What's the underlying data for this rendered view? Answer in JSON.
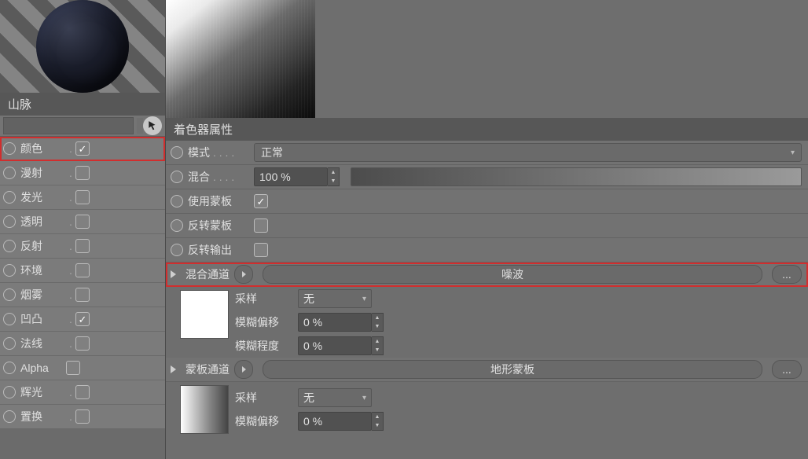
{
  "material_name": "山脉",
  "channels": [
    {
      "id": "color",
      "label": "颜色",
      "checked": true,
      "highlight": true
    },
    {
      "id": "diffuse",
      "label": "漫射",
      "checked": false
    },
    {
      "id": "luminance",
      "label": "发光",
      "checked": false
    },
    {
      "id": "transparency",
      "label": "透明",
      "checked": false
    },
    {
      "id": "reflection",
      "label": "反射",
      "checked": false
    },
    {
      "id": "environment",
      "label": "环境",
      "checked": false
    },
    {
      "id": "fog",
      "label": "烟雾",
      "checked": false
    },
    {
      "id": "bump",
      "label": "凹凸",
      "checked": true
    },
    {
      "id": "normal",
      "label": "法线",
      "checked": false
    },
    {
      "id": "alpha",
      "label": "Alpha",
      "checked": false
    },
    {
      "id": "glow",
      "label": "辉光",
      "checked": false
    },
    {
      "id": "displacement",
      "label": "置换",
      "checked": false
    }
  ],
  "shader_section_title": "着色器属性",
  "mode": {
    "label": "模式",
    "value": "正常"
  },
  "blend": {
    "label": "混合",
    "value": "100 %"
  },
  "use_mask": {
    "label": "使用蒙板",
    "checked": true
  },
  "invert_mask": {
    "label": "反转蒙板",
    "checked": false
  },
  "invert_output": {
    "label": "反转输出",
    "checked": false
  },
  "blend_channel": {
    "label": "混合通道",
    "value": "噪波",
    "more": "..."
  },
  "blend_sub": {
    "sampling": {
      "label": "采样",
      "value": "无"
    },
    "blur_offset": {
      "label": "模糊偏移",
      "value": "0 %"
    },
    "blur_scale": {
      "label": "模糊程度",
      "value": "0 %"
    }
  },
  "mask_channel": {
    "label": "蒙板通道",
    "value": "地形蒙板",
    "more": "..."
  },
  "mask_sub": {
    "sampling": {
      "label": "采样",
      "value": "无"
    },
    "blur_offset": {
      "label": "模糊偏移",
      "value": "0 %"
    }
  }
}
